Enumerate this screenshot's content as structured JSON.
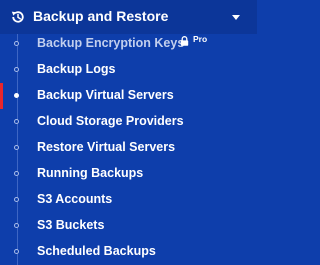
{
  "menu": {
    "section_title": "Backup and Restore",
    "section_icon": "backup-restore-icon",
    "expand_icon": "caret-down-icon",
    "items": [
      {
        "label": "Backup Encryption Keys",
        "badge": "Pro",
        "locked": true,
        "muted": true,
        "active": false
      },
      {
        "label": "Backup Logs",
        "active": false
      },
      {
        "label": "Backup Virtual Servers",
        "active": true
      },
      {
        "label": "Cloud Storage Providers",
        "active": false
      },
      {
        "label": "Restore Virtual Servers",
        "active": false
      },
      {
        "label": "Running Backups",
        "active": false
      },
      {
        "label": "S3 Accounts",
        "active": false
      },
      {
        "label": "S3 Buckets",
        "active": false
      },
      {
        "label": "Scheduled Backups",
        "active": false
      }
    ]
  },
  "colors": {
    "background": "#0e3eab",
    "header_background": "#0c3699",
    "active_marker": "#e8262c",
    "text": "#ffffff",
    "muted_text": "#c2cfee"
  }
}
